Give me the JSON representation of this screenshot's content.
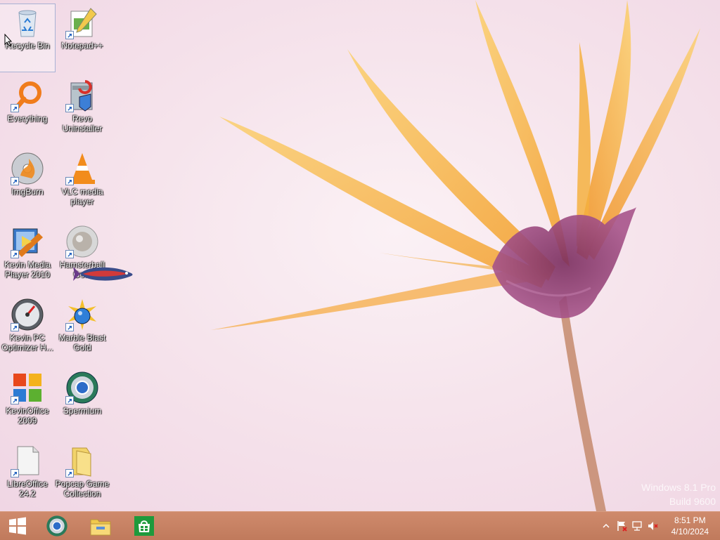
{
  "desktop": {
    "icons": [
      {
        "label": "Recycle Bin",
        "icon": "recycle-bin-icon"
      },
      {
        "label": "Notepad++",
        "icon": "notepad-plus-plus-icon"
      },
      {
        "label": "Everything",
        "icon": "everything-search-icon"
      },
      {
        "label": "Revo Uninstaller",
        "icon": "revo-uninstaller-icon"
      },
      {
        "label": "ImgBurn",
        "icon": "imgburn-icon"
      },
      {
        "label": "VLC media player",
        "icon": "vlc-icon"
      },
      {
        "label": "Kevin Media Player 2010",
        "icon": "media-player-icon"
      },
      {
        "label": "Hamsterball Gold",
        "icon": "hamsterball-icon"
      },
      {
        "label": "Kevin PC Optimizer H...",
        "icon": "pc-optimizer-icon"
      },
      {
        "label": "Marble Blast Gold",
        "icon": "marble-blast-icon"
      },
      {
        "label": "KevinOffice 2009",
        "icon": "office-icon"
      },
      {
        "label": "Spermium",
        "icon": "spermium-browser-icon"
      },
      {
        "label": "LibreOffice 24.2",
        "icon": "libreoffice-icon"
      },
      {
        "label": "Popcap Game Collection",
        "icon": "folder-icon"
      }
    ],
    "watermark": {
      "line1": "Windows 8.1 Pro",
      "line2": "Build 9600"
    }
  },
  "taskbar": {
    "start_icon": "windows-logo-icon",
    "pinned": [
      {
        "name": "Spermium",
        "icon": "spermium-browser-icon"
      },
      {
        "name": "File Explorer",
        "icon": "file-explorer-icon"
      },
      {
        "name": "Store",
        "icon": "store-icon"
      }
    ],
    "tray": {
      "icons": [
        "show-hidden-icons-chevron",
        "action-center-flag-icon",
        "network-icon",
        "volume-muted-icon"
      ],
      "time": "8:51 PM",
      "date": "4/10/2024"
    }
  },
  "colors": {
    "taskbar": "#c8826a",
    "wallpaper_bg": "#f6e4ec",
    "petal": "#f7b84a"
  }
}
